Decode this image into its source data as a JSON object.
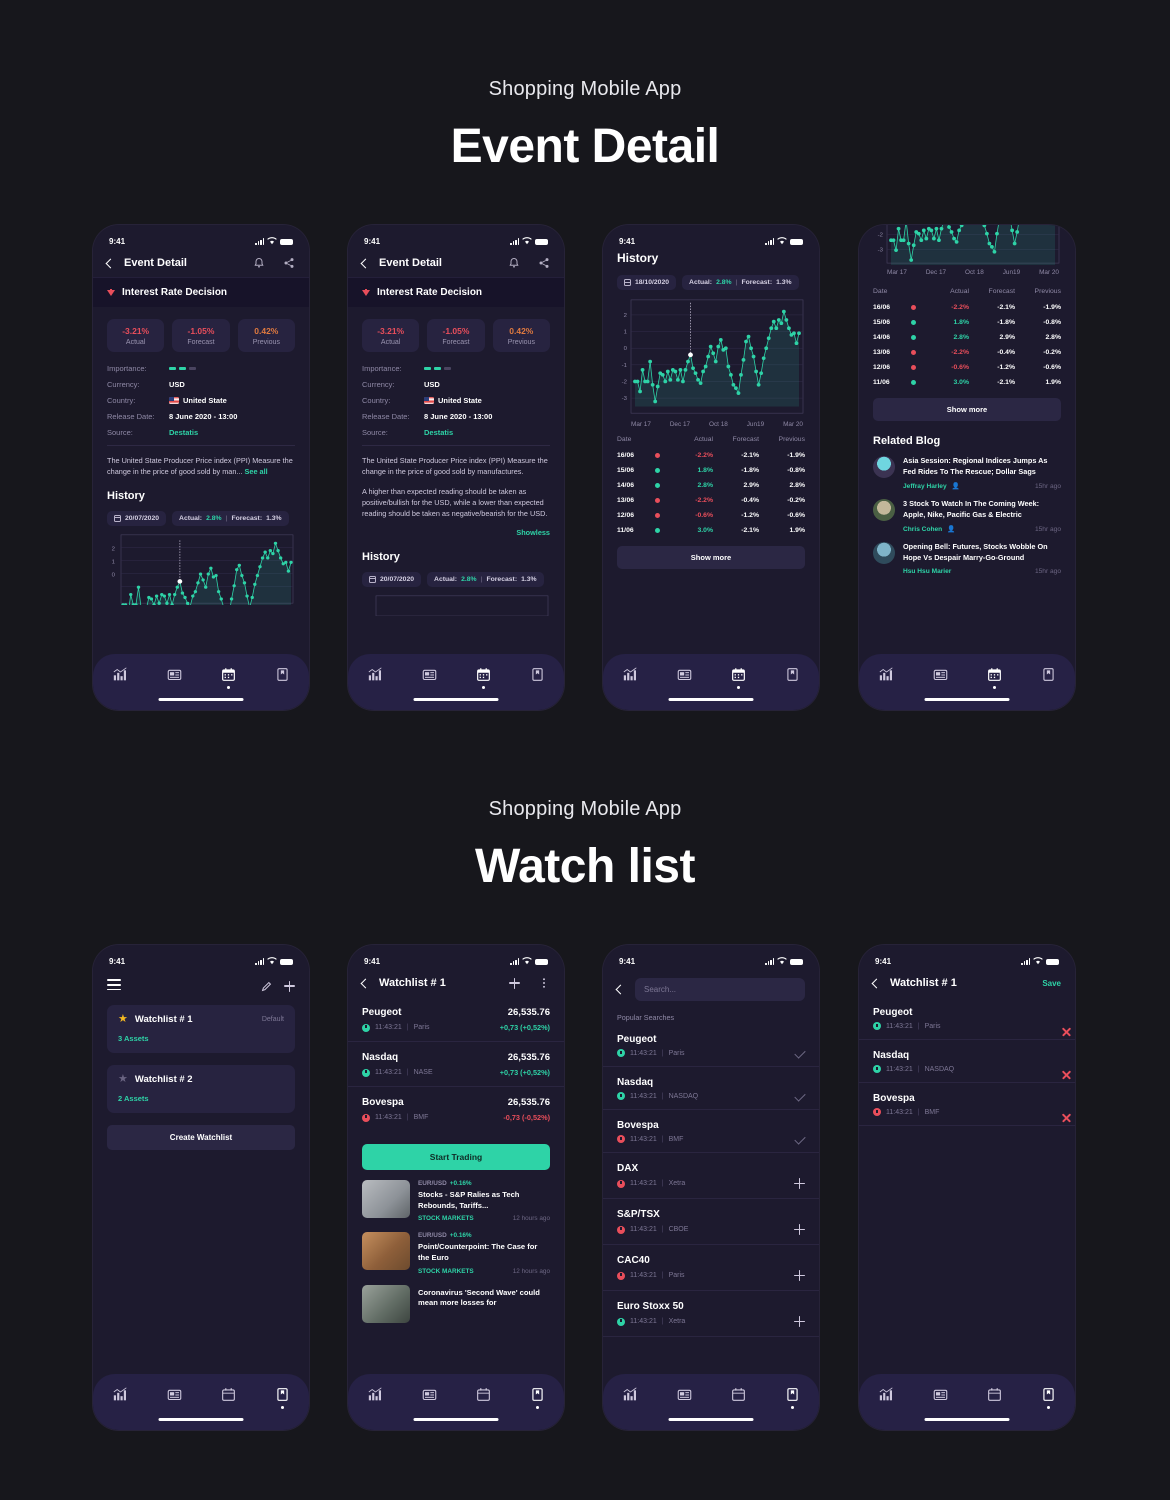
{
  "sections": [
    {
      "subtitle": "Shopping Mobile App",
      "title": "Event Detail"
    },
    {
      "subtitle": "Shopping Mobile App",
      "title": "Watch list"
    }
  ],
  "status_bar": {
    "time": "9:41"
  },
  "event": {
    "nav_title": "Event Detail",
    "banner_title": "Interest Rate Decision",
    "stats": [
      {
        "value": "-3.21%",
        "label": "Actual",
        "color": "#e94e5b"
      },
      {
        "value": "-1.05%",
        "label": "Forecast",
        "color": "#e94e5b"
      },
      {
        "value": "0.42%",
        "label": "Previous",
        "color": "#e07a3f"
      }
    ],
    "meta": [
      {
        "key": "Importance:",
        "value": ""
      },
      {
        "key": "Currency:",
        "value": "USD"
      },
      {
        "key": "Country:",
        "value": "United State"
      },
      {
        "key": "Release Date:",
        "value": "8 June 2020 - 13:00"
      },
      {
        "key": "Source:",
        "value": "Destatis"
      }
    ],
    "importance_filled": 2,
    "importance_total": 3,
    "desc_short": "The United State Producer Price index (PPI) Measure the change in the price of good sold by man...",
    "see_all": "See all",
    "desc_full_p1": "The United State Producer Price index (PPI) Measure the change in the price of good sold by manufactures.",
    "desc_full_p2": "A higher than expected reading should be taken as positive/bullish for the USD, while a lower than expected reading should be taken as negative/bearish for the USD.",
    "show_less": "Showless",
    "history_heading": "History"
  },
  "chart_head": {
    "date_small": "20/07/2020",
    "date_large": "18/10/2020",
    "actual_label": "Actual:",
    "actual_value": "2.8%",
    "forecast_label": "Forecast:",
    "forecast_value": "1.3%"
  },
  "history_page": {
    "title": "History",
    "show_more": "Show more"
  },
  "chart_data": {
    "type": "line",
    "title": "History",
    "xlabel": "",
    "ylabel": "",
    "ylim": [
      -3.5,
      2.5
    ],
    "yticks": [
      2,
      1,
      0,
      -1,
      -2,
      -3
    ],
    "xticks": [
      "Mar 17",
      "Dec 17",
      "Oct 18",
      "Jun19",
      "Mar 20"
    ],
    "grid": true,
    "marker_index": 22,
    "marker_value": -0.4,
    "series": [
      {
        "name": "Actual",
        "color": "#2ed3a7",
        "values": [
          -2.0,
          -2.0,
          -2.6,
          -1.3,
          -2.0,
          -2.0,
          -0.8,
          -2.2,
          -3.2,
          -2.3,
          -1.5,
          -1.6,
          -2.0,
          -1.4,
          -1.9,
          -1.3,
          -1.4,
          -1.9,
          -1.3,
          -2.0,
          -1.3,
          -0.8,
          -0.4,
          -1.2,
          -1.5,
          -1.9,
          -2.1,
          -1.4,
          -1.1,
          -0.5,
          0.1,
          -0.3,
          -0.8,
          0.1,
          0.5,
          -0.1,
          0.0,
          -1.1,
          -1.6,
          -2.2,
          -2.4,
          -2.7,
          -1.6,
          -0.7,
          0.4,
          0.7,
          0.0,
          -0.5,
          -1.4,
          -2.2,
          -1.5,
          -0.6,
          0.0,
          0.6,
          1.2,
          1.6,
          1.2,
          1.7,
          1.5,
          2.2,
          1.7,
          1.2,
          0.8,
          0.9,
          0.3,
          0.9
        ]
      }
    ]
  },
  "history_table": {
    "headers": [
      "Date",
      "Actual",
      "Forecast",
      "Previous"
    ],
    "rows": [
      {
        "date": "16/06",
        "dir": "down",
        "actual": "-2.2%",
        "forecast": "-2.1%",
        "previous": "-1.9%"
      },
      {
        "date": "15/06",
        "dir": "up",
        "actual": "1.8%",
        "forecast": "-1.8%",
        "previous": "-0.8%"
      },
      {
        "date": "14/06",
        "dir": "up",
        "actual": "2.8%",
        "forecast": "2.9%",
        "previous": "2.8%"
      },
      {
        "date": "13/06",
        "dir": "down",
        "actual": "-2.2%",
        "forecast": "-0.4%",
        "previous": "-0.2%"
      },
      {
        "date": "12/06",
        "dir": "down",
        "actual": "-0.6%",
        "forecast": "-1.2%",
        "previous": "-0.6%"
      },
      {
        "date": "11/06",
        "dir": "up",
        "actual": "3.0%",
        "forecast": "-2.1%",
        "previous": "1.9%"
      }
    ]
  },
  "related_blog": {
    "heading": "Related Blog",
    "items": [
      {
        "title": "Asia Session: Regional Indices Jumps As Fed Rides To The Rescue; Dollar Sags",
        "author": "Jeffray Harley",
        "time": "15hr ago"
      },
      {
        "title": "3 Stock To Watch In The Coming Week: Apple, Nike, Pacific Gas & Electric",
        "author": "Chris Cohen",
        "time": "15hr ago"
      },
      {
        "title": "Opening Bell: Futures, Stocks Wobble On Hope Vs Despair Marry-Go-Ground",
        "author": "Hsu Hsu Marier",
        "time": "15hr ago"
      }
    ]
  },
  "watchlists_page": {
    "cards": [
      {
        "name": "Watchlist # 1",
        "badge": "Default",
        "assets": "3 Assets",
        "starred": true
      },
      {
        "name": "Watchlist # 2",
        "badge": "",
        "assets": "2 Assets",
        "starred": false
      }
    ],
    "create_label": "Create Watchlist"
  },
  "watchlist_detail": {
    "title": "Watchlist # 1",
    "save_label": "Save",
    "start_trading": "Start Trading",
    "assets": [
      {
        "name": "Peugeot",
        "price": "26,535.76",
        "time": "11:43:21",
        "market": "Paris",
        "market_long": "Paris",
        "change": "+0,73 (+0,52%)",
        "dir": "up"
      },
      {
        "name": "Nasdaq",
        "price": "26,535.76",
        "time": "11:43:21",
        "market": "NASE",
        "market_long": "NASDAQ",
        "change": "+0,73 (+0,52%)",
        "dir": "up"
      },
      {
        "name": "Bovespa",
        "price": "26,535.76",
        "time": "11:43:21",
        "market": "BMF",
        "market_long": "BMF",
        "change": "-0,73 (-0,52%)",
        "dir": "down"
      }
    ]
  },
  "news": {
    "items": [
      {
        "pair": "EUR/USD",
        "delta": "+0.16%",
        "title": "Stocks - S&P Ralies as Tech Rebounds, Tariffs...",
        "category": "STOCK MARKETS",
        "time": "12 hours ago"
      },
      {
        "pair": "EUR/USD",
        "delta": "+0.16%",
        "title": "Point/Counterpoint: The Case for the Euro",
        "category": "STOCK MARKETS",
        "time": "12 hours ago"
      },
      {
        "pair": "",
        "delta": "",
        "title": "Coronavirus 'Second Wave' could mean more losses for",
        "category": "",
        "time": ""
      }
    ]
  },
  "search_page": {
    "placeholder": "Search...",
    "section_label": "Popular Searches",
    "results": [
      {
        "name": "Peugeot",
        "time": "11:43:21",
        "market": "Paris",
        "dir": "up",
        "action": "check"
      },
      {
        "name": "Nasdaq",
        "time": "11:43:21",
        "market": "NASDAQ",
        "dir": "up",
        "action": "check"
      },
      {
        "name": "Bovespa",
        "time": "11:43:21",
        "market": "BMF",
        "dir": "down",
        "action": "check"
      },
      {
        "name": "DAX",
        "time": "11:43:21",
        "market": "Xetra",
        "dir": "down",
        "action": "plus"
      },
      {
        "name": "S&P/TSX",
        "time": "11:43:21",
        "market": "CBOE",
        "dir": "down",
        "action": "plus"
      },
      {
        "name": "CAC40",
        "time": "11:43:21",
        "market": "Paris",
        "dir": "down",
        "action": "plus"
      },
      {
        "name": "Euro Stoxx 50",
        "time": "11:43:21",
        "market": "Xetra",
        "dir": "up",
        "action": "plus"
      }
    ]
  },
  "tabs": [
    {
      "name": "chart-tab",
      "icon": "bar-chart-icon"
    },
    {
      "name": "news-tab",
      "icon": "news-icon"
    },
    {
      "name": "calendar-tab",
      "icon": "calendar-icon"
    },
    {
      "name": "bookmark-tab",
      "icon": "bookmark-icon"
    }
  ],
  "colors": {
    "accent": "#2ed3a7",
    "negative": "#e94e5b",
    "warning": "#e07a3f",
    "card": "#272340",
    "bg": "#1d1a2e"
  }
}
